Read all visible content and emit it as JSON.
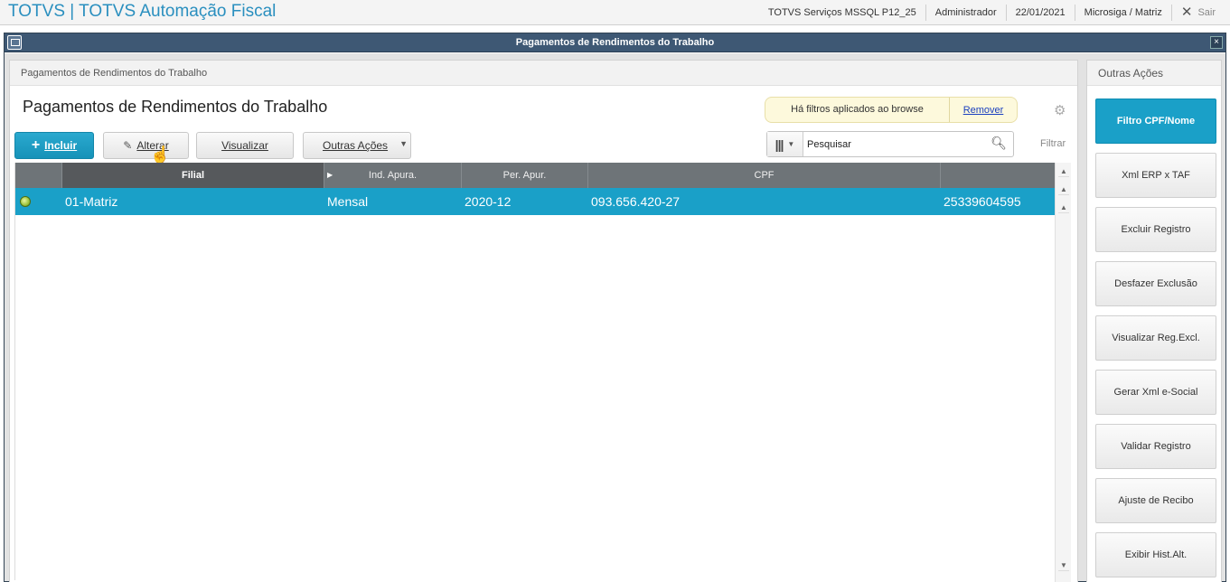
{
  "topbar": {
    "app_title": "TOTVS | TOTVS Automação Fiscal",
    "environment": "TOTVS Serviços MSSQL P12_25",
    "user": "Administrador",
    "date": "22/01/2021",
    "branch": "Microsiga / Matriz",
    "exit_label": "Sair"
  },
  "window": {
    "title": "Pagamentos de Rendimentos do Trabalho",
    "close_glyph": "×"
  },
  "main": {
    "breadcrumb": "Pagamentos de Rendimentos do Trabalho",
    "title": "Pagamentos de Rendimentos do Trabalho",
    "filter_notice": "Há filtros aplicados ao browse",
    "filter_remove": "Remover",
    "buttons": {
      "incluir": "Incluir",
      "alterar": "Alterar",
      "visualizar": "Visualizar",
      "outras_acoes": "Outras Ações"
    },
    "search": {
      "placeholder": "Pesquisar",
      "value": ""
    },
    "filter_label": "Filtrar",
    "grid": {
      "columns": [
        "",
        "Filial",
        "Ind. Apura.",
        "Per. Apur.",
        "CPF",
        ""
      ],
      "rows": [
        {
          "status": "green",
          "filial": "01-Matriz",
          "ind_apura": "Mensal",
          "per_apur": "2020-12",
          "cpf": "093.656.420-27",
          "extra": "25339604595"
        }
      ]
    }
  },
  "side": {
    "title": "Outras Ações",
    "buttons": [
      "Filtro CPF/Nome",
      "Xml ERP x TAF",
      "Excluir Registro",
      "Desfazer Exclusão",
      "Visualizar Reg.Excl.",
      "Gerar Xml e-Social",
      "Validar Registro",
      "Ajuste de Recibo",
      "Exibir Hist.Alt."
    ]
  },
  "colors": {
    "accent": "#1aa0c8",
    "title_blue": "#2a8fbf",
    "window_header": "#3e5874",
    "grid_header": "#6e7478",
    "status_ok": "#9bc23a"
  }
}
